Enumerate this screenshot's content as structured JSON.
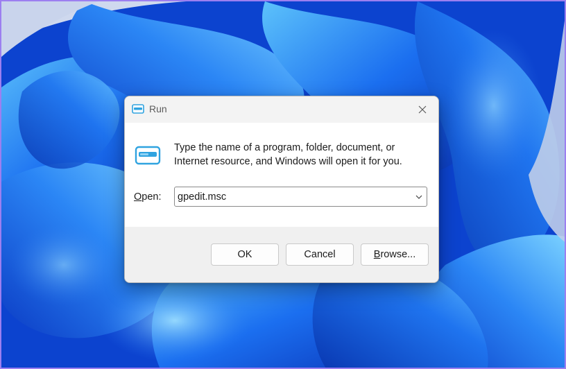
{
  "dialog": {
    "title": "Run",
    "description_line1": "Type the name of a program, folder, document, or",
    "description_line2": "Internet resource, and Windows will open it for you.",
    "open_label_accel": "O",
    "open_label_rest": "pen:",
    "open_value": "gpedit.msc",
    "buttons": {
      "ok": "OK",
      "cancel": "Cancel",
      "browse_accel": "B",
      "browse_rest": "rowse..."
    }
  },
  "icons": {
    "title": "run-icon",
    "app": "run-icon",
    "close": "close-icon",
    "dropdown": "chevron-down-icon"
  },
  "colors": {
    "wallpaper_base": "#0a3ec7",
    "wallpaper_light": "#4fb0f7",
    "titlebar": "#f3f3f3",
    "footer": "#f0f0f0",
    "icon_accent": "#2fa3e0"
  }
}
